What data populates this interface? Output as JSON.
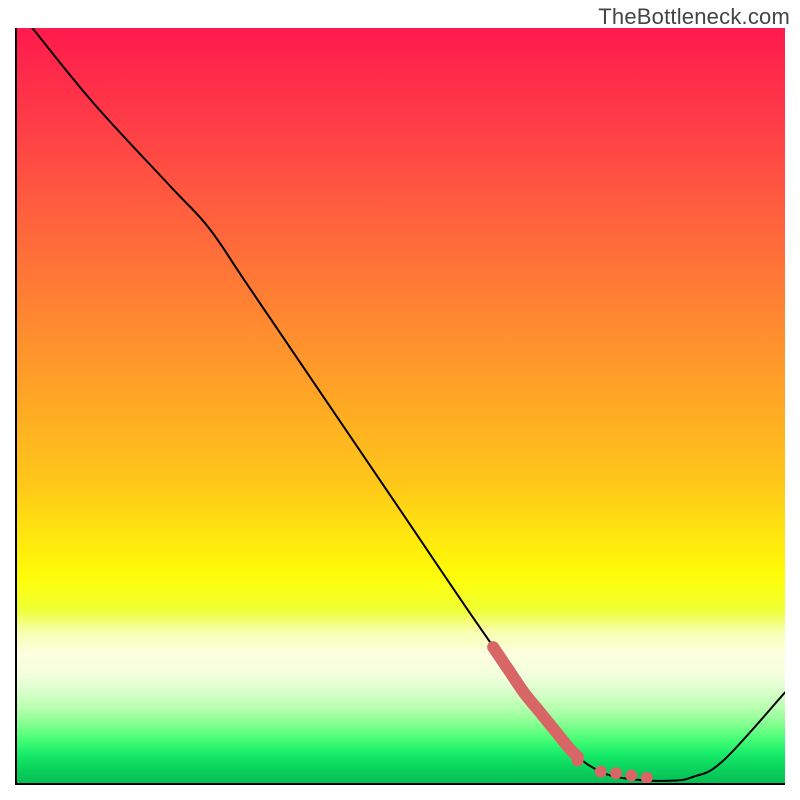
{
  "watermark": "TheBottleneck.com",
  "chart_data": {
    "type": "line",
    "title": "",
    "xlabel": "",
    "ylabel": "",
    "xlim": [
      0,
      100
    ],
    "ylim": [
      0,
      100
    ],
    "grid": false,
    "legend": false,
    "background": {
      "gradient_stops": [
        {
          "pct": 0,
          "color": "#ff1a4d"
        },
        {
          "pct": 50,
          "color": "#ffb520"
        },
        {
          "pct": 72,
          "color": "#fffa08"
        },
        {
          "pct": 86,
          "color": "#d8ffc9"
        },
        {
          "pct": 100,
          "color": "#05bf53"
        }
      ]
    },
    "series": [
      {
        "name": "bottleneck-curve",
        "color": "#000000",
        "x": [
          2,
          10,
          20,
          25,
          30,
          40,
          50,
          60,
          67,
          72,
          76,
          80,
          85,
          88,
          92,
          100
        ],
        "y": [
          100,
          90,
          79,
          73.5,
          66,
          51,
          36,
          21,
          11,
          4.5,
          1.5,
          0.5,
          0.3,
          0.8,
          3,
          12
        ]
      }
    ],
    "highlight_segment": {
      "name": "highlight-red-segment",
      "color": "#e06666",
      "x": [
        62,
        64,
        66,
        68,
        70,
        72,
        73,
        74,
        76,
        78,
        80,
        82
      ],
      "y": [
        18,
        15,
        12,
        9.5,
        7,
        4.5,
        3.5,
        2.8,
        1.5,
        1,
        0.7,
        0.5
      ],
      "style": "thick-with-dots",
      "dot_x": [
        73,
        76,
        78,
        80,
        82
      ],
      "dot_y": [
        3.0,
        1.5,
        1.3,
        1.0,
        0.7
      ]
    }
  }
}
